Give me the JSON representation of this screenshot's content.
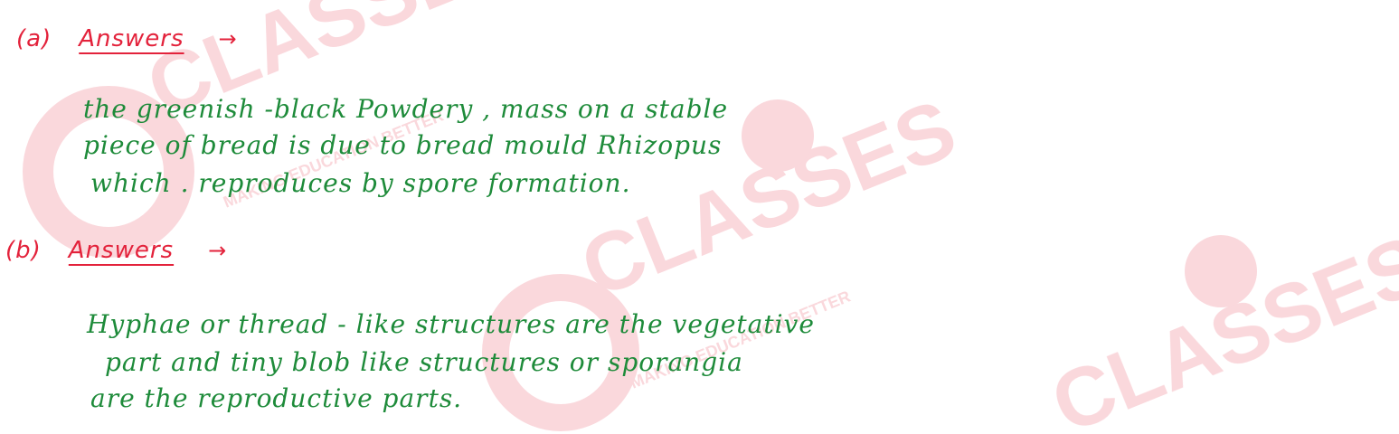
{
  "watermark": {
    "brand_text": "CLASSES",
    "tagline": "MAKING EDUCATION BETTER",
    "color": "#f3b0b0"
  },
  "colors": {
    "label": "#e3223b",
    "answer_text": "#1e8b3a"
  },
  "part_a": {
    "marker": "(a)",
    "label": "Answers",
    "arrow": "→",
    "lines": [
      "the     greenish  -black     Powdery , mass     on   a    stable",
      "piece    of   bread    is   due     to    bread    mould     Rhizopus",
      "which .   reproduces      by     spore      formation."
    ]
  },
  "part_b": {
    "marker": "(b)",
    "label": "Answers",
    "arrow": "→",
    "lines": [
      "Hyphae     or   thread  - like    structures    are    the    vegetative",
      "part   and   tiny     blob   like    structures     or    sporangia",
      "are     the     reproductive     parts."
    ]
  }
}
